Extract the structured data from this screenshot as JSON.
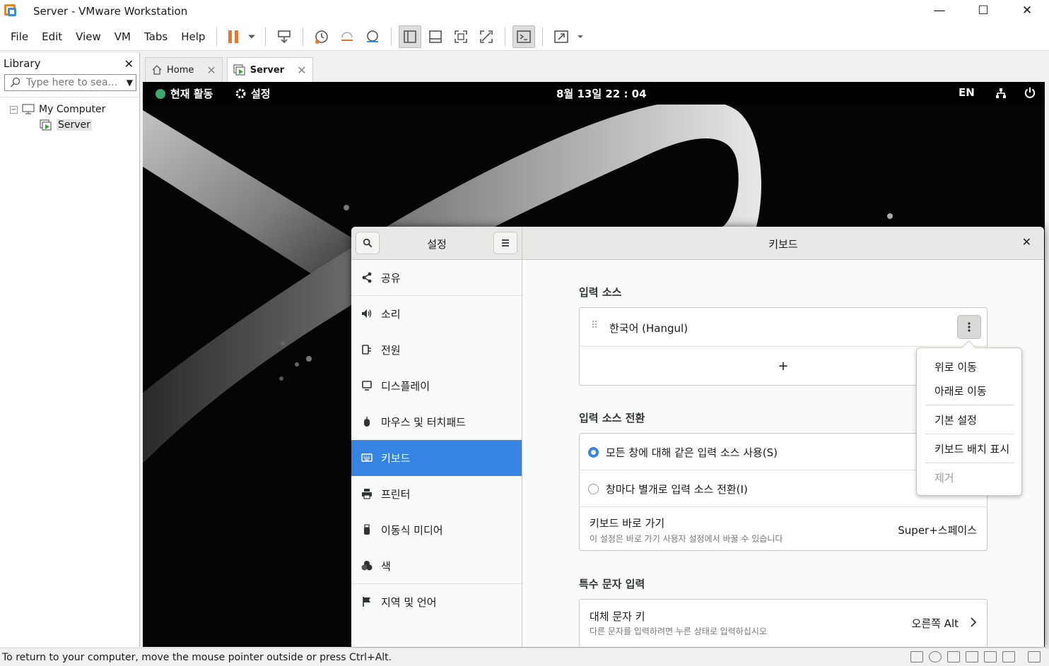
{
  "window": {
    "title": "Server - VMware Workstation",
    "minimize": "—",
    "maximize": "☐",
    "close": "✕"
  },
  "menu": {
    "file": "File",
    "edit": "Edit",
    "view": "View",
    "vm": "VM",
    "tabs": "Tabs",
    "help": "Help"
  },
  "library": {
    "title": "Library",
    "close": "✕",
    "search_placeholder": "Type here to sea...",
    "tree": {
      "root": "My Computer",
      "child": "Server"
    }
  },
  "tabs": [
    {
      "label": "Home",
      "close": "✕"
    },
    {
      "label": "Server",
      "close": "✕"
    }
  ],
  "guest": {
    "activities": "현재 활동",
    "settings": "설정",
    "clock": "8월 13일  22 : 04",
    "lang": "EN"
  },
  "settings_window": {
    "sidebar_title": "설정",
    "panel_title": "키보드",
    "close": "✕",
    "sidebar": [
      {
        "label": "공유",
        "icon": "share-icon"
      },
      {
        "label": "소리",
        "icon": "speaker-icon"
      },
      {
        "label": "전원",
        "icon": "power-plug-icon"
      },
      {
        "label": "디스플레이",
        "icon": "display-icon"
      },
      {
        "label": "마우스 및 터치패드",
        "icon": "mouse-icon"
      },
      {
        "label": "키보드",
        "icon": "keyboard-icon",
        "active": true
      },
      {
        "label": "프린터",
        "icon": "printer-icon"
      },
      {
        "label": "이동식 미디어",
        "icon": "usb-icon"
      },
      {
        "label": "색",
        "icon": "color-icon"
      },
      {
        "label": "지역 및 언어",
        "icon": "flag-icon"
      }
    ],
    "input_sources": {
      "heading": "입력 소스",
      "source": "한국어 (Hangul)",
      "add": "+"
    },
    "switching": {
      "heading": "입력 소스 전환",
      "option_same": "모든 창에 대해 같은 입력 소스 사용(S)",
      "option_per_window": "창마다 별개로 입력 소스 전환(I)",
      "shortcut_title": "키보드 바로 가기",
      "shortcut_sub": "이 설정은 바로 가기 사용자 설정에서 바꿀 수 있습니다",
      "shortcut_value": "Super+스페이스"
    },
    "special": {
      "heading": "특수 문자 입력",
      "alt_title": "대체 문자 키",
      "alt_sub": "다른 문자를 입력하려면 누른 상태로 입력하십시오",
      "alt_value": "오른쪽 Alt"
    },
    "popover": {
      "move_up": "위로 이동",
      "move_down": "아래로 이동",
      "preferences": "기본 설정",
      "show_layout": "키보드 배치 표시",
      "remove": "제거"
    }
  },
  "statusbar": {
    "message": "To return to your computer, move the mouse pointer outside or press Ctrl+Alt."
  },
  "colors": {
    "accent": "#3584e4",
    "pause": "#e8762c",
    "brand_green": "#3daa6f"
  }
}
